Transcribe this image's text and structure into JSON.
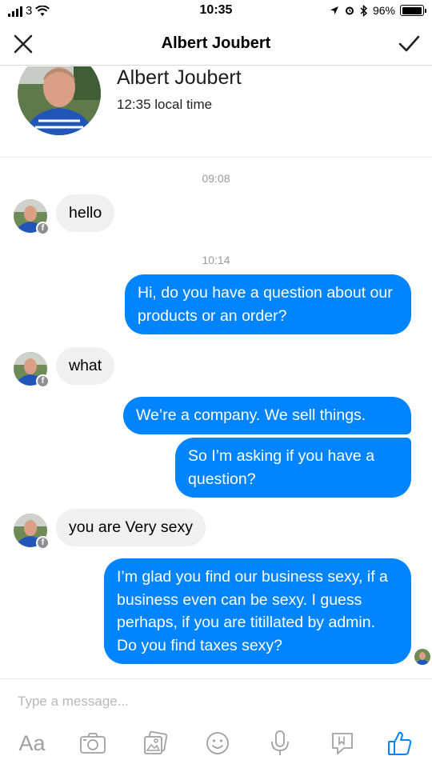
{
  "status_bar": {
    "carrier": "3",
    "time": "10:35",
    "battery": "96%",
    "battery_level": 0.96
  },
  "nav": {
    "title": "Albert Joubert"
  },
  "profile": {
    "name": "Albert Joubert",
    "local_time": "12:35 local time"
  },
  "messages": {
    "ts1": "09:08",
    "m1": "hello",
    "ts2": "10:14",
    "m2": "Hi, do you have a question about our products or an order?",
    "m3": "what",
    "m4": "We’re a company. We sell things.",
    "m5": "So I’m asking if you have a question?",
    "m6": "you are Very sexy",
    "m7": "I’m glad you find our business sexy, if a business even can be sexy. I guess perhaps, if you are titillated by admin. Do you find taxes sexy?"
  },
  "composer": {
    "placeholder": "Type a message...",
    "aa_label": "Aa"
  },
  "colors": {
    "outgoing_bubble": "#0084ff",
    "incoming_bubble": "#f1f0f0",
    "icon_gray": "#a0a0a0",
    "like_icon": "#0084ff"
  },
  "icons": [
    "signal-icon",
    "wifi-icon",
    "location-icon",
    "alarm-icon",
    "bluetooth-icon",
    "battery-icon",
    "close-icon",
    "checkmark-icon",
    "facebook-badge-icon",
    "camera-icon",
    "gallery-icon",
    "emoji-icon",
    "microphone-icon",
    "sticker-icon",
    "like-icon"
  ]
}
